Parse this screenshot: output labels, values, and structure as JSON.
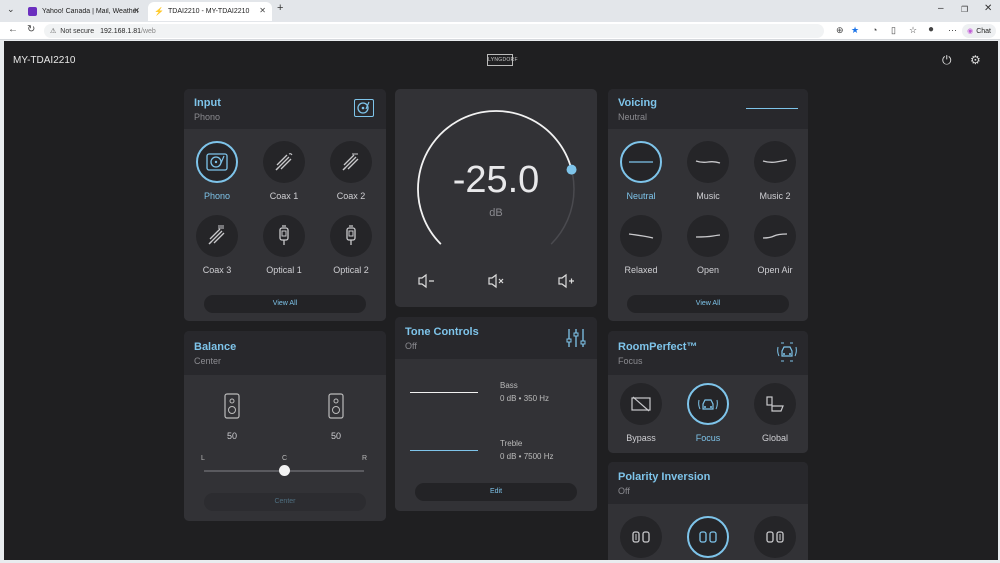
{
  "browser": {
    "tabs": [
      {
        "title": "Yahoo! Canada | Mail, Weather, Se",
        "active": false
      },
      {
        "title": "TDAI2210 - MY-TDAI2210",
        "active": true
      }
    ],
    "new_tab": "+",
    "security": "Not secure",
    "url_host": "192.168.1.81",
    "url_path": "/web",
    "chat_label": "Chat"
  },
  "app": {
    "device_name": "MY-TDAI2210",
    "brand": "LYNGDORF"
  },
  "input": {
    "title": "Input",
    "selected": "Phono",
    "options": [
      {
        "label": "Phono",
        "icon": "turntable-icon",
        "selected": true
      },
      {
        "label": "Coax 1",
        "icon": "coax-icon",
        "selected": false
      },
      {
        "label": "Coax 2",
        "icon": "coax-icon",
        "selected": false
      },
      {
        "label": "Coax 3",
        "icon": "coax-icon",
        "selected": false
      },
      {
        "label": "Optical 1",
        "icon": "optical-icon",
        "selected": false
      },
      {
        "label": "Optical 2",
        "icon": "optical-icon",
        "selected": false
      }
    ],
    "view_all": "View All"
  },
  "volume": {
    "value": "-25.0",
    "unit": "dB",
    "level_fraction": 0.78
  },
  "voicing": {
    "title": "Voicing",
    "selected": "Neutral",
    "options": [
      {
        "label": "Neutral",
        "selected": true
      },
      {
        "label": "Music",
        "selected": false
      },
      {
        "label": "Music 2",
        "selected": false
      },
      {
        "label": "Relaxed",
        "selected": false
      },
      {
        "label": "Open",
        "selected": false
      },
      {
        "label": "Open Air",
        "selected": false
      }
    ],
    "view_all": "View All"
  },
  "balance": {
    "title": "Balance",
    "value_label": "Center",
    "left_value": "50",
    "right_value": "50",
    "l": "L",
    "c": "C",
    "r": "R",
    "position_fraction": 0.5,
    "center_button": "Center"
  },
  "tone": {
    "title": "Tone Controls",
    "status": "Off",
    "bass_label": "Bass",
    "bass_value": "0 dB • 350 Hz",
    "treble_label": "Treble",
    "treble_value": "0 dB • 7500 Hz",
    "edit": "Edit"
  },
  "roomperfect": {
    "title": "RoomPerfect™",
    "selected": "Focus",
    "options": [
      {
        "label": "Bypass",
        "selected": false
      },
      {
        "label": "Focus",
        "selected": true
      },
      {
        "label": "Global",
        "selected": false
      }
    ]
  },
  "polarity": {
    "title": "Polarity Inversion",
    "status": "Off"
  },
  "colors": {
    "accent": "#7ec4ea",
    "background": "#1f1f21",
    "card": "#2b2b2f"
  }
}
